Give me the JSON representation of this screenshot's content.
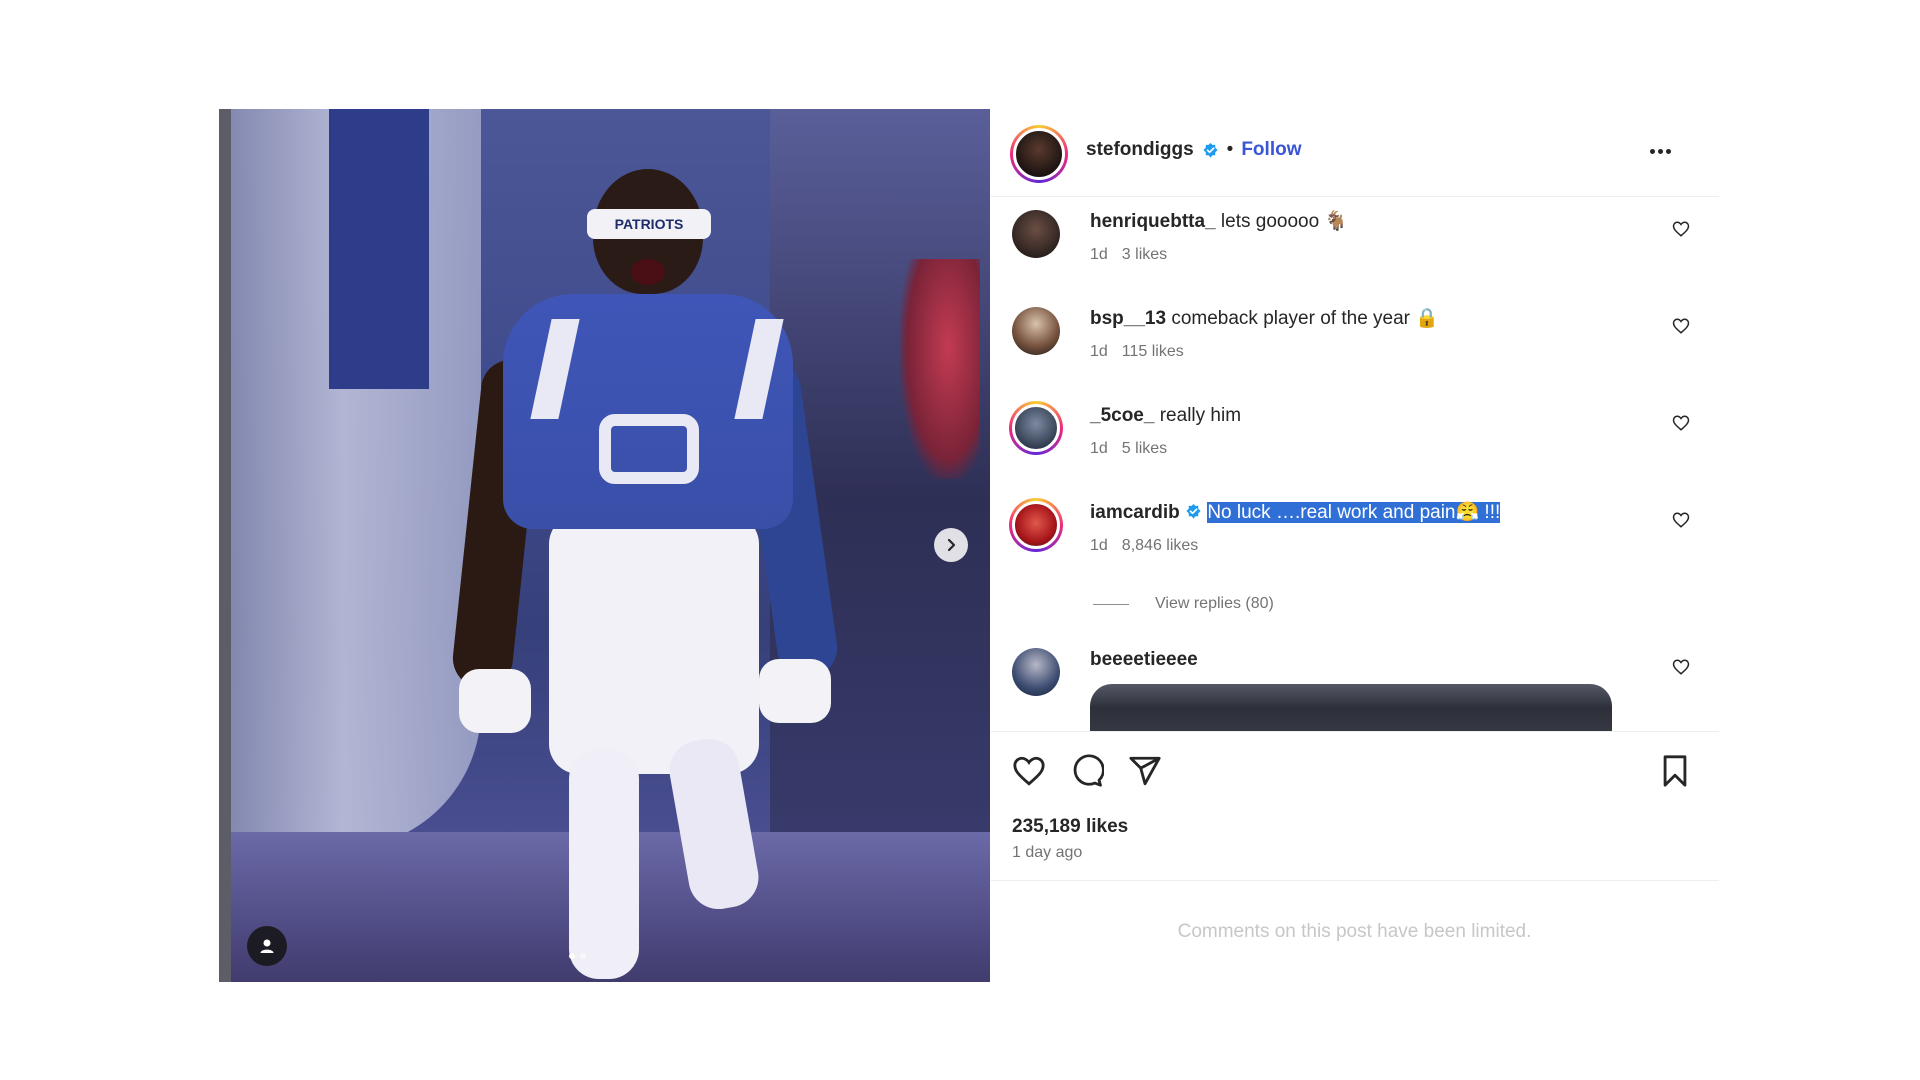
{
  "post": {
    "author": "stefondiggs",
    "follow_label": "Follow",
    "separator": "•",
    "headband_text": "PATRIOTS",
    "likes": "235,189 likes",
    "time": "1 day ago",
    "comments_limited": "Comments on this post have been limited.",
    "carousel": {
      "current": 1,
      "total": 2
    }
  },
  "comments": [
    {
      "user": "henriquebtta_",
      "text": "lets gooooo 🐐",
      "age": "1d",
      "likes": "3 likes",
      "avatar_color": "#3a2a25"
    },
    {
      "user": "bsp__13",
      "text": "comeback player of the year 🔒",
      "age": "1d",
      "likes": "115 likes",
      "avatar_color": "#6b4c3b"
    },
    {
      "user": "_5coe_",
      "text": "really him",
      "age": "1d",
      "likes": "5 likes",
      "avatar_color": "#45556d"
    },
    {
      "user": "iamcardib",
      "text": "No luck ….real work and pain😤 !!!",
      "age": "1d",
      "likes": "8,846 likes",
      "avatar_color": "#c2241d"
    },
    {
      "user": "beeeetieeee",
      "text": "",
      "avatar_color": "#2f3e5e"
    }
  ],
  "view_replies": "View replies (80)",
  "colors": {
    "accent": "#3a55d6",
    "verified": "#1d9bf0",
    "highlight": "#2f6fd6"
  },
  "icons": [
    "chevron-right-icon",
    "user-tag-icon",
    "more-icon",
    "heart-icon",
    "comment-icon",
    "share-icon",
    "bookmark-icon",
    "verified-icon"
  ]
}
